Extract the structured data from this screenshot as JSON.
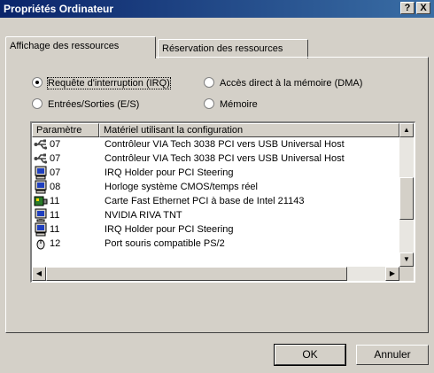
{
  "window": {
    "title": "Propriétés Ordinateur",
    "help_label": "?",
    "close_label": "X"
  },
  "tabs": [
    {
      "label": "Affichage des ressources",
      "active": true
    },
    {
      "label": "Réservation des ressources",
      "active": false
    }
  ],
  "radios": [
    {
      "label": "Requête d'interruption (IRQ)",
      "checked": true
    },
    {
      "label": "Accès direct à la mémoire (DMA)",
      "checked": false
    },
    {
      "label": "Entrées/Sorties (E/S)",
      "checked": false
    },
    {
      "label": "Mémoire",
      "checked": false
    }
  ],
  "list": {
    "columns": [
      "Paramètre",
      "Matériel utilisant la configuration"
    ],
    "rows": [
      {
        "icon": "usb-icon",
        "irq": "07",
        "device": "Contrôleur VIA Tech 3038 PCI vers USB Universal Host"
      },
      {
        "icon": "usb-icon",
        "irq": "07",
        "device": "Contrôleur VIA Tech 3038 PCI vers USB Universal Host"
      },
      {
        "icon": "computer-icon",
        "irq": "07",
        "device": "IRQ Holder pour PCI Steering"
      },
      {
        "icon": "computer-icon",
        "irq": "08",
        "device": "Horloge système CMOS/temps réel"
      },
      {
        "icon": "network-card-icon",
        "irq": "11",
        "device": "Carte Fast Ethernet PCI à base de Intel 21143"
      },
      {
        "icon": "display-icon",
        "irq": "11",
        "device": "NVIDIA RIVA TNT"
      },
      {
        "icon": "computer-icon",
        "irq": "11",
        "device": "IRQ Holder pour PCI Steering"
      },
      {
        "icon": "mouse-icon",
        "irq": "12",
        "device": "Port souris compatible PS/2"
      }
    ],
    "vscroll_position": 0.55
  },
  "buttons": {
    "ok": "OK",
    "cancel": "Annuler"
  }
}
